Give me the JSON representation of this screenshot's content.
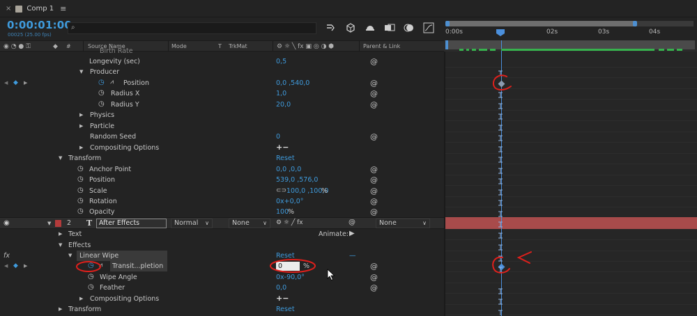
{
  "tab": {
    "close": "×",
    "title": "Comp 1",
    "menu": "≡"
  },
  "header": {
    "timecode": "0:00:01:00",
    "frames": "00025 (25.00 fps)",
    "search_icon": "⌕"
  },
  "ruler": {
    "ticks": [
      "0:00s",
      "02s",
      "03s",
      "04s"
    ]
  },
  "columns": {
    "source_name": "Source Name",
    "mode": "Mode",
    "t": "T",
    "trkmat": "TrkMat",
    "parent": "Parent & Link",
    "hash": "#"
  },
  "rows": {
    "clipped": "Birth Rate",
    "longevity": {
      "label": "Longevity (sec)",
      "value": "0,5"
    },
    "producer": "Producer",
    "position": {
      "label": "Position",
      "value": "0,0 ,540,0"
    },
    "radius_x": {
      "label": "Radius X",
      "value": "1,0"
    },
    "radius_y": {
      "label": "Radius Y",
      "value": "20,0"
    },
    "physics": "Physics",
    "particle": "Particle",
    "random_seed": {
      "label": "Random Seed",
      "value": "0"
    },
    "compositing1": {
      "label": "Compositing Options",
      "value": "+−"
    },
    "transform1": {
      "label": "Transform",
      "value": "Reset"
    },
    "anchor": {
      "label": "Anchor Point",
      "value": "0,0 ,0,0"
    },
    "tpos": {
      "label": "Position",
      "value": "539,0 ,576,0"
    },
    "scale": {
      "label": "Scale",
      "value": "100,0 ,100,0",
      "unit": "%"
    },
    "rotation": {
      "label": "Rotation",
      "value": "0x+0,0°"
    },
    "opacity": {
      "label": "Opacity",
      "value": "100",
      "unit": "%"
    }
  },
  "layer": {
    "num": "2",
    "name": "After Effects",
    "mode": "Normal",
    "trkmat": "None",
    "parent": "None"
  },
  "layer_children": {
    "text": "Text",
    "animate": "Animate:",
    "effects": "Effects",
    "fx": "fx",
    "linear_wipe": {
      "label": "Linear Wipe",
      "value": "Reset",
      "dash": "—"
    },
    "transition": {
      "label": "Transit...pletion",
      "value": "0",
      "unit": "%"
    },
    "wipe_angle": {
      "label": "Wipe Angle",
      "value": "0x-90,0°"
    },
    "feather": {
      "label": "Feather",
      "value": "0,0"
    },
    "compositing2": {
      "label": "Compositing Options",
      "value": "+−"
    },
    "transform2": {
      "label": "Transform",
      "value": "Reset"
    }
  },
  "colors": {
    "accent": "#3f9bdd",
    "layer_bar": "#a84b4b",
    "annotation": "#e0201c",
    "layer_label": "#b33b3b"
  }
}
